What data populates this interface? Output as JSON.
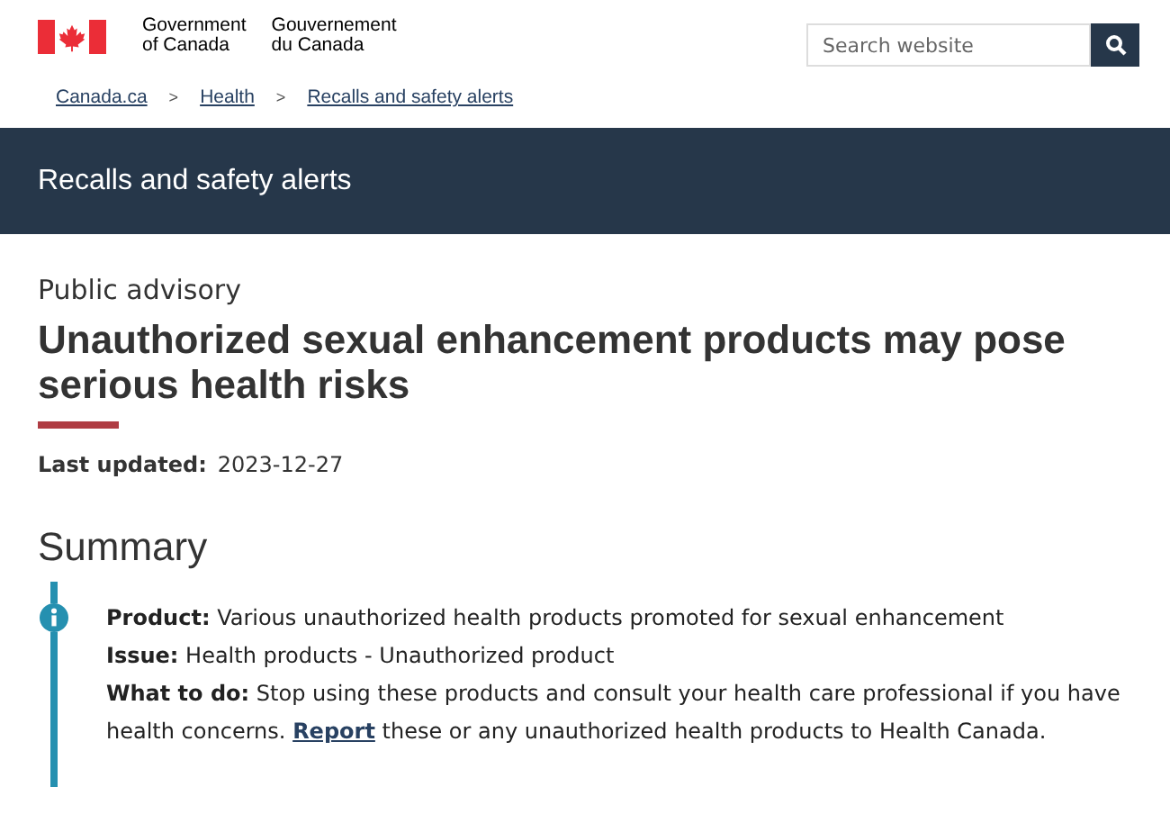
{
  "header": {
    "wordmark_en": [
      "Government",
      "of Canada"
    ],
    "wordmark_fr": [
      "Gouvernement",
      "du Canada"
    ],
    "search": {
      "placeholder": "Search website"
    }
  },
  "breadcrumbs": [
    {
      "label": "Canada.ca",
      "separator": ">"
    },
    {
      "label": "Health",
      "separator": ">"
    },
    {
      "label": "Recalls and safety alerts"
    }
  ],
  "banner": {
    "title": "Recalls and safety alerts"
  },
  "page": {
    "kicker": "Public advisory",
    "title": "Unauthorized sexual enhancement products may pose serious health risks",
    "updated_label": "Last updated:",
    "updated_value": "2023-12-27"
  },
  "summary": {
    "heading": "Summary",
    "rows": [
      {
        "text": "**Product:**  Various unauthorized health products promoted for sexual enhancement"
      },
      {
        "text": "**Issue:**  Health products - Unauthorized product"
      },
      {
        "text": "**What to do:**  Stop using these products and consult your health care professional if you have health concerns.",
        "link": "Report",
        "after": "these or any unauthorized health products to Health Canada."
      }
    ]
  }
}
